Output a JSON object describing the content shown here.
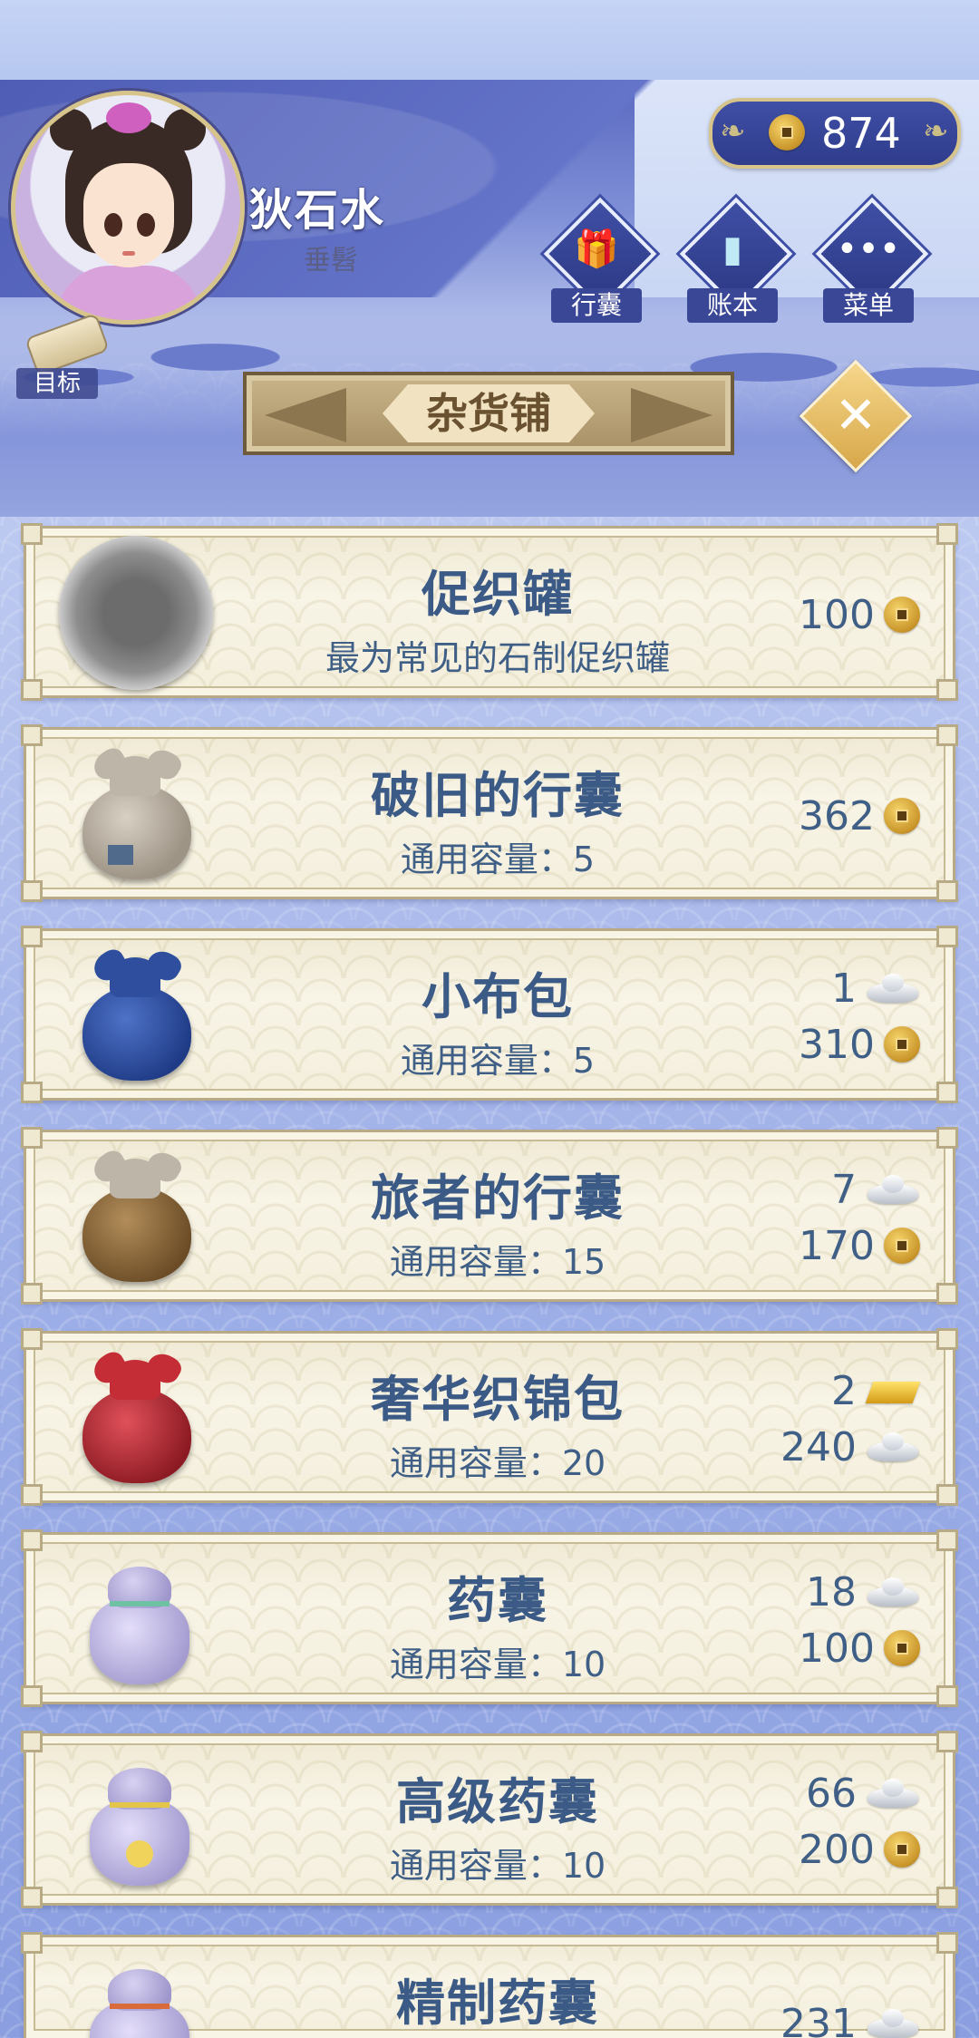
{
  "player": {
    "name": "狄石水",
    "title": "垂髫"
  },
  "currency": {
    "coins": "874"
  },
  "menu": [
    {
      "label": "行囊",
      "icon": "bag-icon"
    },
    {
      "label": "账本",
      "icon": "ledger-icon"
    },
    {
      "label": "菜单",
      "icon": "more-icon"
    }
  ],
  "goal_label": "目标",
  "shop_title": "杂货铺",
  "close_icon": "close-icon",
  "items": [
    {
      "name": "促织罐",
      "desc": "最为常见的石制促织罐",
      "prices": [
        {
          "amount": "100",
          "currency": "coin"
        }
      ]
    },
    {
      "name": "破旧的行囊",
      "desc": "通用容量：5",
      "prices": [
        {
          "amount": "362",
          "currency": "coin"
        }
      ]
    },
    {
      "name": "小布包",
      "desc": "通用容量：5",
      "prices": [
        {
          "amount": "1",
          "currency": "silver"
        },
        {
          "amount": "310",
          "currency": "coin"
        }
      ]
    },
    {
      "name": "旅者的行囊",
      "desc": "通用容量：15",
      "prices": [
        {
          "amount": "7",
          "currency": "silver"
        },
        {
          "amount": "170",
          "currency": "coin"
        }
      ]
    },
    {
      "name": "奢华织锦包",
      "desc": "通用容量：20",
      "prices": [
        {
          "amount": "2",
          "currency": "gold"
        },
        {
          "amount": "240",
          "currency": "silver"
        }
      ]
    },
    {
      "name": "药囊",
      "desc": "通用容量：10",
      "prices": [
        {
          "amount": "18",
          "currency": "silver"
        },
        {
          "amount": "100",
          "currency": "coin"
        }
      ]
    },
    {
      "name": "高级药囊",
      "desc": "通用容量：10",
      "prices": [
        {
          "amount": "66",
          "currency": "silver"
        },
        {
          "amount": "200",
          "currency": "coin"
        }
      ]
    },
    {
      "name": "精制药囊",
      "desc": "",
      "prices": [
        {
          "amount": "231",
          "currency": "silver"
        }
      ]
    }
  ],
  "colors": {
    "accent_gold": "#d7c48a",
    "header_blue": "#3f4fa5",
    "item_text": "#3b5a86"
  }
}
